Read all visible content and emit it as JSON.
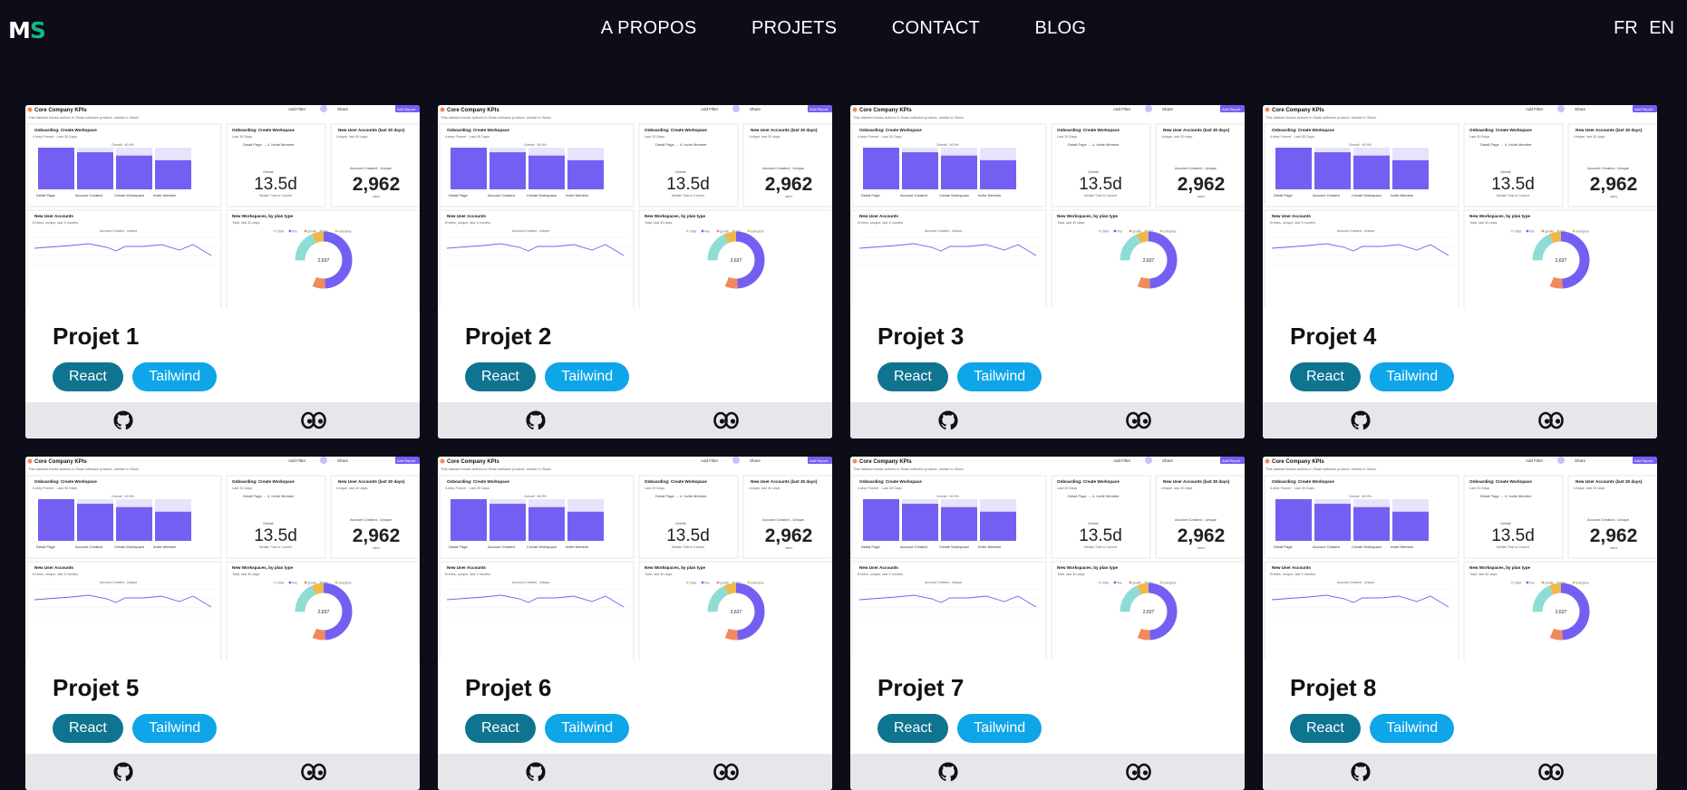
{
  "logo": {
    "m": "M",
    "s": "S"
  },
  "nav": [
    "A PROPOS",
    "PROJETS",
    "CONTACT",
    "BLOG"
  ],
  "lang": [
    "FR",
    "EN"
  ],
  "dashboard": {
    "title": "Core Company KPIs",
    "subtitle": "This dataset tracks actions in Saas software product, similar to Slack.",
    "add_filter": "Add Filter",
    "share": "Share",
    "add_report": "Add Report",
    "funnel_title": "Onboarding: Create Workspace",
    "funnel_sub": "4-step Funnel · Last 30 Days",
    "funnel_legend": "Overall · 60.9%",
    "funnel_steps": [
      "Detail Page",
      "Account Created",
      "Create Workspace",
      "Invite Member"
    ],
    "funnel_values": [
      100,
      89,
      81,
      70
    ],
    "time_title": "Onboarding: Create Workspace",
    "time_sub": "Last 30 Days",
    "time_steps": "Detail Page → 4. Invite Member",
    "time_overall": "Overall",
    "time_value": "13.5d",
    "time_caption": "Median Time to Convert",
    "users_title": "New User Accounts (last 30 days)",
    "users_sub": "Unique, last 30 days",
    "users_legend": "Account Created - Unique",
    "users_value": "2,962",
    "users_unit": "users",
    "line_title": "New User Accounts",
    "line_sub": "Entries, unique, last 3 months",
    "line_legend": "Account Created - Unique",
    "donut_title": "New Workspaces, by plan type",
    "donut_sub": "Total, last 30 days",
    "donut_legend": [
      "Other",
      "free",
      "growth",
      "trial",
      "enterprise"
    ],
    "donut_value": "2,637"
  },
  "projects": [
    {
      "title": "Projet 1",
      "tags": [
        "React",
        "Tailwind"
      ]
    },
    {
      "title": "Projet 2",
      "tags": [
        "React",
        "Tailwind"
      ]
    },
    {
      "title": "Projet 3",
      "tags": [
        "React",
        "Tailwind"
      ]
    },
    {
      "title": "Projet 4",
      "tags": [
        "React",
        "Tailwind"
      ]
    },
    {
      "title": "Projet 5",
      "tags": [
        "React",
        "Tailwind"
      ]
    },
    {
      "title": "Projet 6",
      "tags": [
        "React",
        "Tailwind"
      ]
    },
    {
      "title": "Projet 7",
      "tags": [
        "React",
        "Tailwind"
      ]
    },
    {
      "title": "Projet 8",
      "tags": [
        "React",
        "Tailwind"
      ]
    }
  ],
  "colors": {
    "purple": "#7360f2",
    "teal": "#8fdcd5",
    "orange": "#f08a5d",
    "yellow": "#eeb94a",
    "react": "#0e7490",
    "tailwind": "#0ea5e9",
    "footer": "#e5e7eb"
  }
}
